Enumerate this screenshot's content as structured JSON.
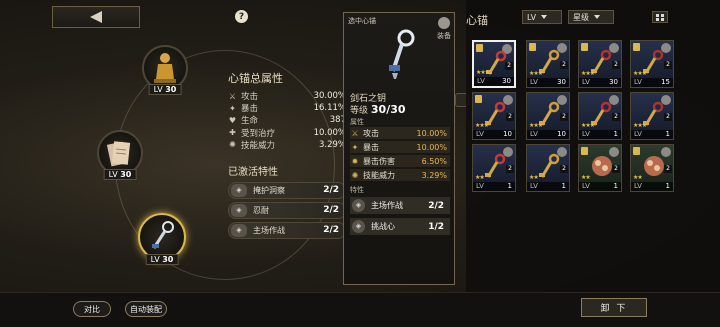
{
  "top": {
    "help_glyph": "?"
  },
  "slots": [
    {
      "lv_label": "LV",
      "lv": "30"
    },
    {
      "lv_label": "LV",
      "lv": "30"
    },
    {
      "lv_label": "LV",
      "lv": "30"
    }
  ],
  "stats": {
    "title": "心锚总属性",
    "rows": [
      {
        "icon": "sword-icon",
        "name": "攻击",
        "value": "30.00%"
      },
      {
        "icon": "crit-icon",
        "name": "暴击",
        "value": "16.11%"
      },
      {
        "icon": "heart-icon",
        "name": "生命",
        "value": "387"
      },
      {
        "icon": "heal-icon",
        "name": "受到治疗",
        "value": "10.00%"
      },
      {
        "icon": "power-icon",
        "name": "技能威力",
        "value": "3.29%"
      }
    ],
    "active_title": "已激活特性",
    "skills": [
      {
        "name": "掩护洞察",
        "count": "2/2"
      },
      {
        "name": "忍耐",
        "count": "2/2"
      },
      {
        "name": "主场作战",
        "count": "2/2"
      }
    ]
  },
  "popup": {
    "header": "选中心锚",
    "equipped": "装备",
    "name": "剑石之钥",
    "level_label": "等级",
    "level": "30/30",
    "attr_label": "属性",
    "stats": [
      {
        "name": "攻击",
        "value": "10.00%"
      },
      {
        "name": "暴击",
        "value": "10.00%"
      },
      {
        "name": "暴击伤害",
        "value": "6.50%"
      },
      {
        "name": "技能威力",
        "value": "3.29%"
      }
    ],
    "trait_label": "特性",
    "skills": [
      {
        "name": "主场作战",
        "count": "2/2"
      },
      {
        "name": "挑战心",
        "count": "1/2"
      }
    ]
  },
  "inventory": {
    "title": "心锚",
    "filter_lv": "LV",
    "filter_star": "星级",
    "items": [
      {
        "lv_label": "LV",
        "lv": "30",
        "stars": "★★★",
        "count": "2",
        "lock": true,
        "color": "blue",
        "selected": true
      },
      {
        "lv_label": "LV",
        "lv": "30",
        "stars": "★★★",
        "count": "2",
        "lock": true,
        "color": "blue",
        "selected": false
      },
      {
        "lv_label": "LV",
        "lv": "30",
        "stars": "★★★",
        "count": "2",
        "lock": true,
        "color": "blue",
        "selected": false
      },
      {
        "lv_label": "LV",
        "lv": "15",
        "stars": "★★★",
        "count": "2",
        "lock": true,
        "color": "blue",
        "selected": false
      },
      {
        "lv_label": "LV",
        "lv": "10",
        "stars": "★★★",
        "count": "2",
        "lock": true,
        "color": "blue",
        "selected": false
      },
      {
        "lv_label": "LV",
        "lv": "10",
        "stars": "★★★",
        "count": "2",
        "lock": false,
        "color": "blue",
        "selected": false
      },
      {
        "lv_label": "LV",
        "lv": "1",
        "stars": "★★★",
        "count": "2",
        "lock": false,
        "color": "blue",
        "selected": false
      },
      {
        "lv_label": "LV",
        "lv": "1",
        "stars": "★★★",
        "count": "2",
        "lock": false,
        "color": "blue",
        "selected": false
      },
      {
        "lv_label": "LV",
        "lv": "1",
        "stars": "★★",
        "count": "2",
        "lock": false,
        "color": "blue",
        "selected": false
      },
      {
        "lv_label": "LV",
        "lv": "1",
        "stars": "★★",
        "count": "2",
        "lock": false,
        "color": "blue",
        "selected": false
      },
      {
        "lv_label": "LV",
        "lv": "1",
        "stars": "★★",
        "count": "2",
        "lock": true,
        "color": "green",
        "selected": false
      },
      {
        "lv_label": "LV",
        "lv": "1",
        "stars": "★★",
        "count": "2",
        "lock": true,
        "color": "green",
        "selected": false
      }
    ]
  },
  "bottom": {
    "compare": "对比",
    "auto_equip": "自动装配",
    "unequip": "卸 下"
  }
}
